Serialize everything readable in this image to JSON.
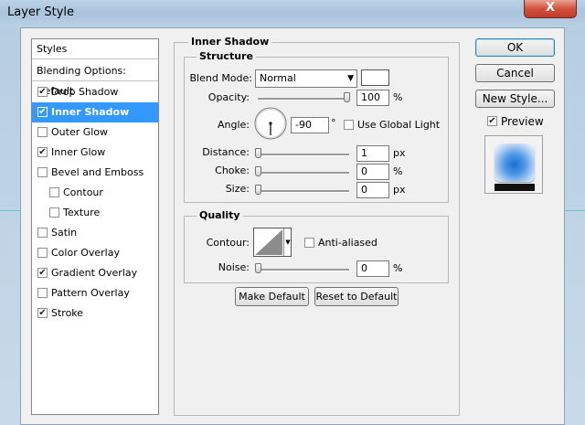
{
  "window": {
    "title": "Layer Style",
    "close_glyph": "X"
  },
  "styles_list": {
    "header": "Styles",
    "blending": "Blending Options: Default",
    "items": [
      {
        "label": "Drop Shadow",
        "checked": true,
        "indent": false,
        "selected": false
      },
      {
        "label": "Inner Shadow",
        "checked": true,
        "indent": false,
        "selected": true
      },
      {
        "label": "Outer Glow",
        "checked": false,
        "indent": false,
        "selected": false
      },
      {
        "label": "Inner Glow",
        "checked": true,
        "indent": false,
        "selected": false
      },
      {
        "label": "Bevel and Emboss",
        "checked": false,
        "indent": false,
        "selected": false
      },
      {
        "label": "Contour",
        "checked": false,
        "indent": true,
        "selected": false
      },
      {
        "label": "Texture",
        "checked": false,
        "indent": true,
        "selected": false
      },
      {
        "label": "Satin",
        "checked": false,
        "indent": false,
        "selected": false
      },
      {
        "label": "Color Overlay",
        "checked": false,
        "indent": false,
        "selected": false
      },
      {
        "label": "Gradient Overlay",
        "checked": true,
        "indent": false,
        "selected": false
      },
      {
        "label": "Pattern Overlay",
        "checked": false,
        "indent": false,
        "selected": false
      },
      {
        "label": "Stroke",
        "checked": true,
        "indent": false,
        "selected": false
      }
    ]
  },
  "inner_shadow": {
    "title": "Inner Shadow",
    "structure": {
      "title": "Structure",
      "blend_mode_label": "Blend Mode:",
      "blend_mode_value": "Normal",
      "blend_color": "#ffffff",
      "opacity_label": "Opacity:",
      "opacity_value": "100",
      "opacity_unit": "%",
      "opacity_level": 1.0,
      "angle_label": "Angle:",
      "angle_value": "-90",
      "angle_unit": "°",
      "use_global_light_label": "Use Global Light",
      "use_global_light_checked": false,
      "distance_label": "Distance:",
      "distance_value": "1",
      "distance_unit": "px",
      "choke_label": "Choke:",
      "choke_value": "0",
      "choke_unit": "%",
      "size_label": "Size:",
      "size_value": "0",
      "size_unit": "px"
    },
    "quality": {
      "title": "Quality",
      "contour_label": "Contour:",
      "anti_aliased_label": "Anti-aliased",
      "anti_aliased_checked": false,
      "noise_label": "Noise:",
      "noise_value": "0",
      "noise_unit": "%"
    },
    "make_default_label": "Make Default",
    "reset_default_label": "Reset to Default"
  },
  "buttons": {
    "ok": "OK",
    "cancel": "Cancel",
    "new_style": "New Style...",
    "preview_label": "Preview",
    "preview_checked": true
  },
  "colors": {
    "selection": "#3399ff",
    "preview_center": "#1a6fd4"
  }
}
